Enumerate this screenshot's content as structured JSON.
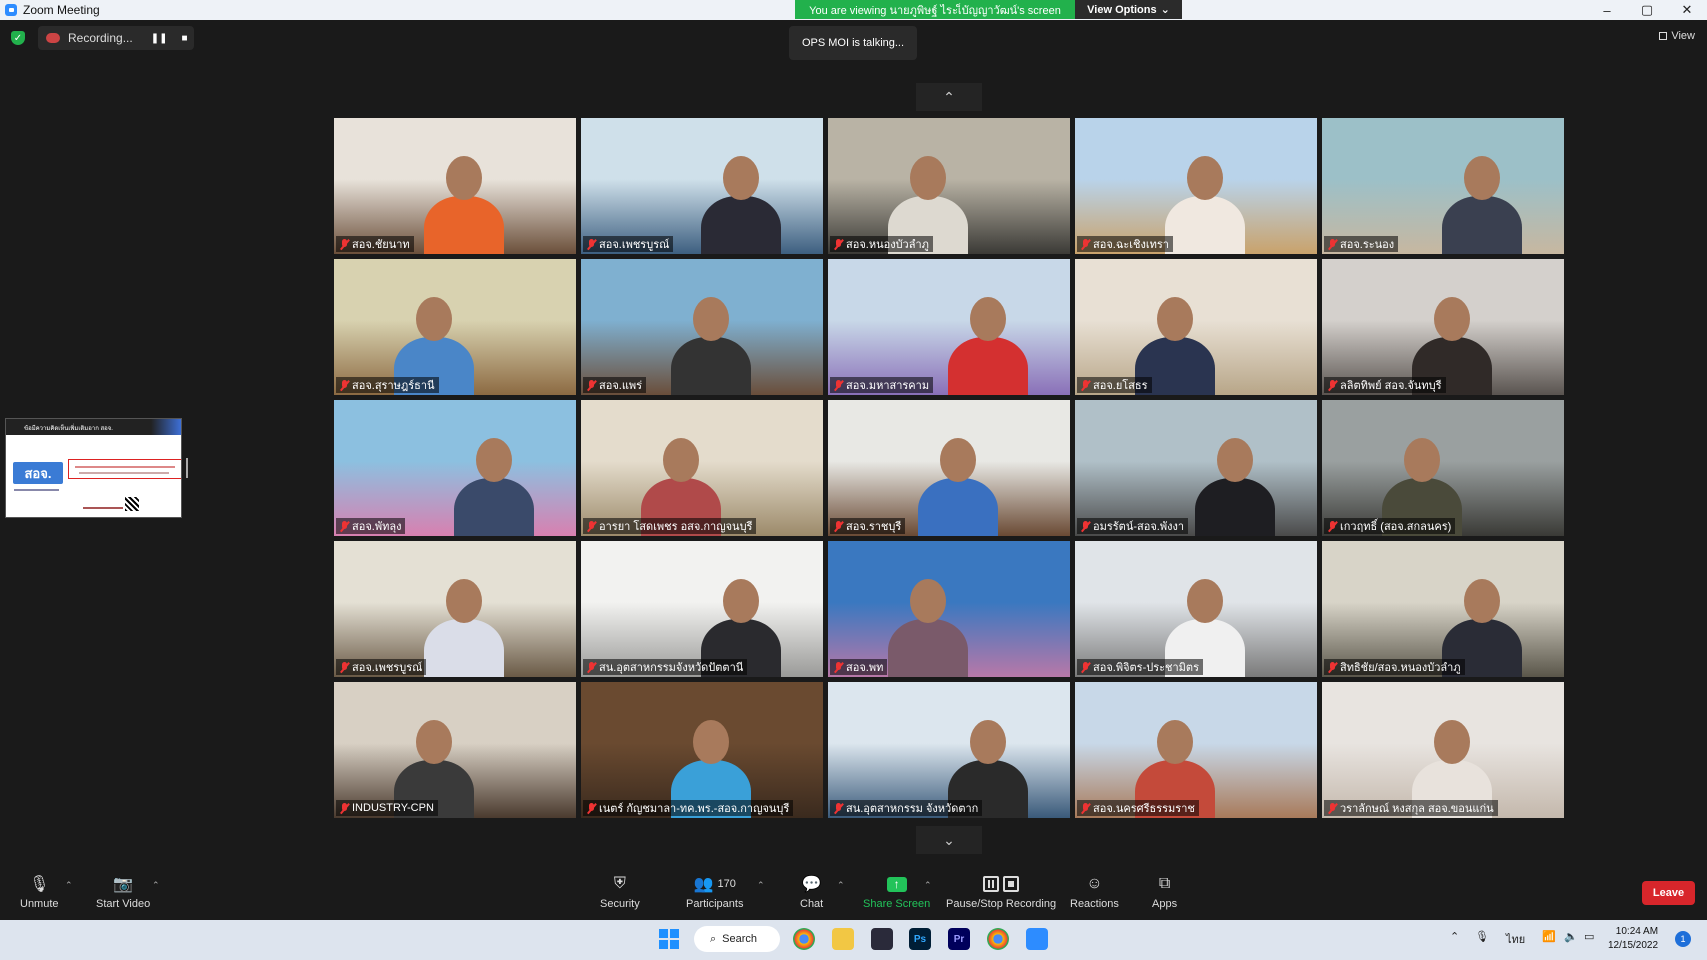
{
  "window": {
    "title": "Zoom Meeting",
    "minimize": "–",
    "maximize": "▢",
    "close": "✕"
  },
  "banner": {
    "viewing_text": "You are viewing นายภูพิษฐ์ ไระเ็บัญญาวัฒน์'s screen",
    "view_options": "View Options",
    "view_options_caret": "⌄"
  },
  "recording": {
    "label": "Recording...",
    "pause": "❚❚",
    "stop": "■"
  },
  "talking": "OPS MOI is talking...",
  "view_button": "View",
  "paging": {
    "up": "⌃",
    "down": "⌄"
  },
  "shared_screen": {
    "header": "ข้อมีความคิดเห็นเพิ่มเติมอาก สอจ.",
    "logo_text": "สอจ."
  },
  "participants": [
    {
      "name": "สอจ.ชัยนาท",
      "bg": [
        "#e8e2da",
        "#6b4f3a"
      ],
      "shirt": "#e8642a"
    },
    {
      "name": "สอจ.เพชรบูรณ์",
      "bg": [
        "#cfe0ea",
        "#3d5f80"
      ],
      "shirt": "#2a2a35"
    },
    {
      "name": "สอจ.หนองบัวลำภู",
      "bg": [
        "#b9b3a5",
        "#3b3a36"
      ],
      "shirt": "#ddd9d0"
    },
    {
      "name": "สอจ.ฉะเชิงเทรา",
      "bg": [
        "#b9d3ea",
        "#c9a26b"
      ],
      "shirt": "#f0e8e0"
    },
    {
      "name": "สอจ.ระนอง",
      "bg": [
        "#9cc0c8",
        "#c7b7a0"
      ],
      "shirt": "#3a4050"
    },
    {
      "name": "สอจ.สุราษฎร์ธานี",
      "bg": [
        "#d8d2b0",
        "#8c6a42"
      ],
      "shirt": "#4a86c8"
    },
    {
      "name": "สอจ.แพร่",
      "bg": [
        "#7fb0d0",
        "#6a4e3a"
      ],
      "shirt": "#333333"
    },
    {
      "name": "สอจ.มหาสารคาม",
      "bg": [
        "#c8d8e8",
        "#8a70b8"
      ],
      "shirt": "#d43030"
    },
    {
      "name": "สอจ.ยโสธร",
      "bg": [
        "#e8e0d4",
        "#b8a688"
      ],
      "shirt": "#2a3450"
    },
    {
      "name": "ลลิตทิพย์ สอจ.จันทบุรี",
      "bg": [
        "#d4d0cc",
        "#5a5450"
      ],
      "shirt": "#302a28"
    },
    {
      "name": "สอจ.พัทลุง",
      "bg": [
        "#8cc0e0",
        "#d880b0"
      ],
      "shirt": "#3a4a6a"
    },
    {
      "name": "อารยา โสดเพชร อสจ.กาญจนบุรี",
      "bg": [
        "#e4dccc",
        "#9c8a6a"
      ],
      "shirt": "#b04a4a"
    },
    {
      "name": "สอจ.ราชบุรี",
      "bg": [
        "#e8e8e4",
        "#6a4a34"
      ],
      "shirt": "#3a70c0"
    },
    {
      "name": "อมรรัตน์-สอจ.พังงา",
      "bg": [
        "#b0c0c8",
        "#4a4a4a"
      ],
      "shirt": "#1e1e22"
    },
    {
      "name": "เกวฤทธิ์ (สอจ.สกลนคร)",
      "bg": [
        "#9aa0a0",
        "#3a3a36"
      ],
      "shirt": "#4a4a3a"
    },
    {
      "name": "สอจ.เพชรบูรณ์",
      "bg": [
        "#e4e0d4",
        "#6a5a46"
      ],
      "shirt": "#dadde8"
    },
    {
      "name": "สน.อุตสาหกรรมจังหวัดปัตตานี",
      "bg": [
        "#f2f2f0",
        "#9a9a98"
      ],
      "shirt": "#2a2a2e"
    },
    {
      "name": "สอจ.พท",
      "bg": [
        "#3a78c0",
        "#b878a8"
      ],
      "shirt": "#7a5a6a"
    },
    {
      "name": "สอจ.พิจิตร-ประชามิตร",
      "bg": [
        "#e0e4e8",
        "#7a7a7a"
      ],
      "shirt": "#f0f0f0"
    },
    {
      "name": "สิทธิชัย/สอจ.หนองบัวลำภู",
      "bg": [
        "#d8d4c8",
        "#5a564a"
      ],
      "shirt": "#2a2c36"
    },
    {
      "name": "INDUSTRY-CPN",
      "bg": [
        "#d8d0c4",
        "#4a3a2e"
      ],
      "shirt": "#3a3a3a"
    },
    {
      "name": "เนตร์ กัญชมาลา-ทค.พร.-สอจ.กาญจนบุรี",
      "bg": [
        "#6a4a30",
        "#3a2a1e"
      ],
      "shirt": "#3aa0d8"
    },
    {
      "name": "สน.อุตสาหกรรม จังหวัดตาก",
      "bg": [
        "#dce6ee",
        "#3a5a7a"
      ],
      "shirt": "#2a2a2a"
    },
    {
      "name": "สอจ.นครศรีธรรมราช",
      "bg": [
        "#c8d8e8",
        "#a87a5a"
      ],
      "shirt": "#c44a3a"
    },
    {
      "name": "วราลักษณ์ หงสกุล สอจ.ขอนแก่น",
      "bg": [
        "#e8e4e0",
        "#c4b8ac"
      ],
      "shirt": "#e8e2dc"
    }
  ],
  "toolbar": {
    "unmute": "Unmute",
    "start_video": "Start Video",
    "security": "Security",
    "participants": "Participants",
    "participants_count": "170",
    "chat": "Chat",
    "share_screen": "Share Screen",
    "pause_stop_recording": "Pause/Stop Recording",
    "reactions": "Reactions",
    "apps": "Apps",
    "leave": "Leave",
    "caret": "⌃"
  },
  "taskbar": {
    "search": "Search",
    "photoshop": "Ps",
    "premiere": "Pr",
    "lang": "ไทย",
    "time": "10:24 AM",
    "date": "12/15/2022",
    "notif_count": "1"
  }
}
